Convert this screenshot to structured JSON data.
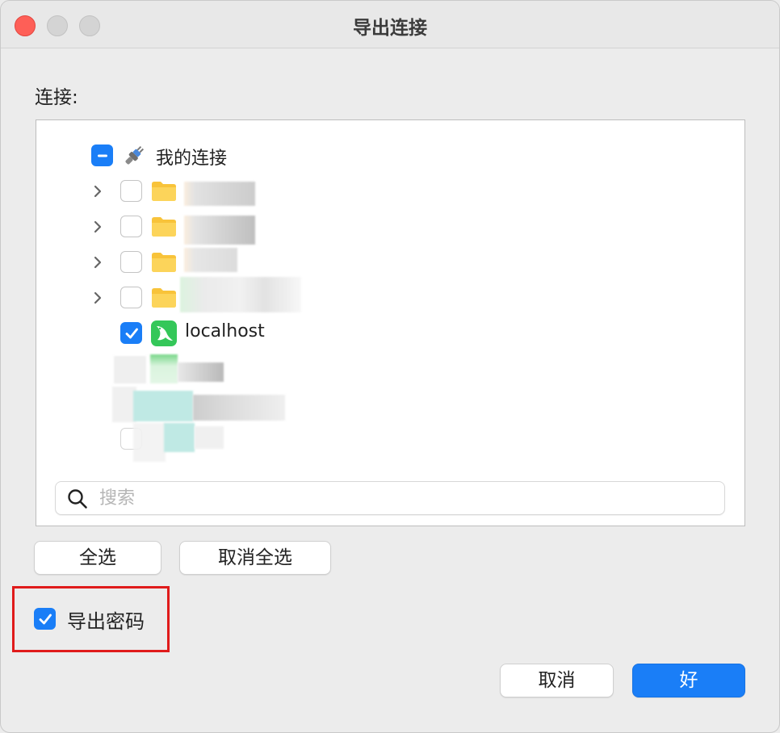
{
  "window": {
    "title": "导出连接"
  },
  "connections_label": "连接:",
  "tree": {
    "root": {
      "label": "我的连接",
      "state": "partial",
      "icon": "plug-icon"
    },
    "folders": [
      {
        "label": "",
        "checked": false,
        "icon": "folder-icon",
        "redacted": true
      },
      {
        "label": "",
        "checked": false,
        "icon": "folder-icon",
        "redacted": true
      },
      {
        "label": "",
        "checked": false,
        "icon": "folder-icon",
        "redacted": true
      },
      {
        "label": "",
        "checked": false,
        "icon": "folder-icon",
        "redacted": true
      }
    ],
    "connections": [
      {
        "label": "localhost",
        "checked": true,
        "icon": "mysql-dolphin-icon"
      }
    ]
  },
  "search": {
    "placeholder": "搜索",
    "value": ""
  },
  "buttons": {
    "select_all": "全选",
    "deselect_all": "取消全选",
    "cancel": "取消",
    "ok": "好"
  },
  "export_password": {
    "label": "导出密码",
    "checked": true
  },
  "colors": {
    "accent": "#1a7ef7",
    "highlight_border": "#e01b1b",
    "folder": "#f8c33a",
    "mysql_icon": "#34c759"
  }
}
